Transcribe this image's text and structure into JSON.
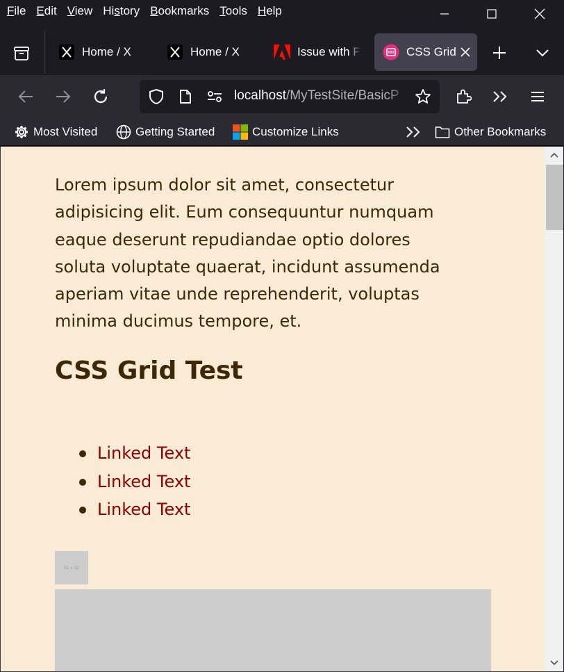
{
  "menubar": {
    "items": [
      {
        "label": "File",
        "key": "F",
        "rest": "ile"
      },
      {
        "label": "Edit",
        "key": "E",
        "rest": "dit"
      },
      {
        "label": "View",
        "key": "V",
        "rest": "iew"
      },
      {
        "label": "History",
        "key": "",
        "pre": "Hi",
        "key2": "s",
        "rest": "tory"
      },
      {
        "label": "Bookmarks",
        "key": "B",
        "rest": "ookmarks"
      },
      {
        "label": "Tools",
        "key": "T",
        "rest": "ools"
      },
      {
        "label": "Help",
        "key": "H",
        "rest": "elp"
      }
    ]
  },
  "tabs": [
    {
      "title": "Home / X",
      "icon": "x-logo-icon",
      "active": false
    },
    {
      "title": "Home / X",
      "icon": "x-logo-icon",
      "active": false
    },
    {
      "title": "Issue with F",
      "icon": "adobe-icon",
      "active": false
    },
    {
      "title": "CSS Grid",
      "icon": "site-favicon-icon",
      "active": true
    }
  ],
  "navbar": {
    "url_host": "localhost",
    "url_path": "/MyTestSite/BasicP"
  },
  "bookmarks": {
    "items": [
      {
        "label": "Most Visited",
        "icon": "gear-icon"
      },
      {
        "label": "Getting Started",
        "icon": "globe-icon"
      },
      {
        "label": "Customize Links",
        "icon": "microsoft-icon"
      }
    ],
    "other_label": "Other Bookmarks"
  },
  "content": {
    "paragraph_lines": [
      "Lorem ipsum dolor sit amet, consectetur",
      "adipisicing elit. Eum consequuntur numquam",
      "eaque deserunt repudiandae optio dolores",
      "soluta voluptate quaerat, incidunt assumenda",
      "aperiam vitae unde reprehenderit, voluptas",
      "minima ducimus tempore, et."
    ],
    "heading": "CSS Grid Test",
    "links": [
      "Linked Text",
      "Linked Text",
      "Linked Text"
    ],
    "thumb_label": "32 x 32"
  },
  "colors": {
    "page_bg": "#faebd7",
    "text": "#3d2705",
    "link": "#8b0000",
    "chrome_dark": "#1c1b22",
    "chrome": "#2b2a33"
  }
}
